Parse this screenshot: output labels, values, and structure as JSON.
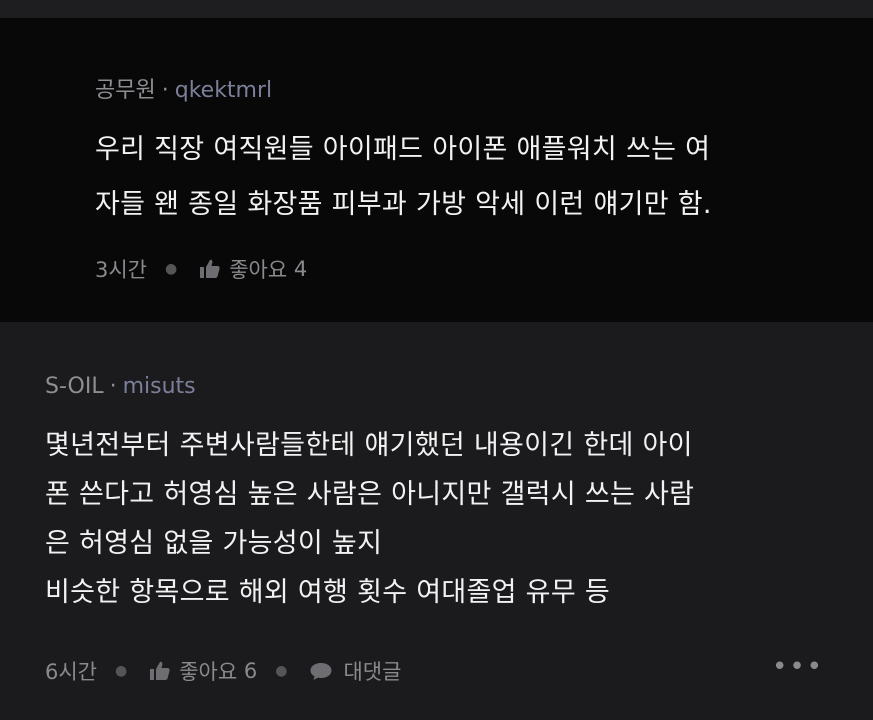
{
  "comments": [
    {
      "nickname": "공무원",
      "separator": "·",
      "user_id": "qkektmrl",
      "lines": [
        "우리 직장 여직원들 아이패드 아이폰 애플워치 쓰는 여",
        "자들 왠 종일 화장품 피부과 가방 악세 이런 얘기만 함."
      ],
      "time": "3시간",
      "like_label": "좋아요",
      "like_count": "4"
    },
    {
      "nickname": "S-OIL",
      "separator": "·",
      "user_id": "misuts",
      "lines": [
        "몇년전부터 주변사람들한테 얘기했던 내용이긴 한데 아이",
        "폰 쓴다고 허영심 높은 사람은 아니지만 갤럭시 쓰는 사람",
        "은 허영심 없을 가능성이 높지",
        "비슷한 항목으로 해외 여행 횟수 여대졸업 유무 등"
      ],
      "time": "6시간",
      "like_label": "좋아요",
      "like_count": "6",
      "reply_label": "대댓글",
      "more_label": "•••"
    }
  ],
  "icons": {
    "like": "thumbs-up-icon",
    "reply": "speech-bubble-icon",
    "more": "more-dots-icon"
  },
  "colors": {
    "first_bg": "#080808",
    "second_bg": "#1b1b1d",
    "text": "#f2f2f2",
    "muted": "#8a8a8e",
    "user_id": "#7c7f9a"
  }
}
